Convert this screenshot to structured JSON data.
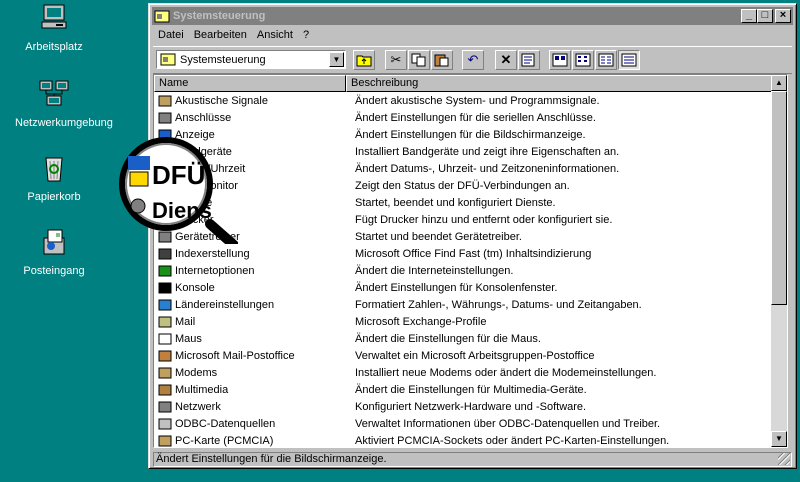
{
  "desktop": {
    "icons": [
      {
        "label": "Arbeitsplatz",
        "icon": "computer-icon"
      },
      {
        "label": "Netzwerkumgebung",
        "icon": "network-icon"
      },
      {
        "label": "Papierkorb",
        "icon": "recycle-bin-icon"
      },
      {
        "label": "Posteingang",
        "icon": "inbox-icon"
      }
    ]
  },
  "window": {
    "title": "Systemsteuerung",
    "controls": {
      "minimize": "_",
      "maximize": "□",
      "close": "×"
    }
  },
  "menu": {
    "items": [
      {
        "label": "Datei",
        "mnemonic": "D"
      },
      {
        "label": "Bearbeiten",
        "mnemonic": "B"
      },
      {
        "label": "Ansicht",
        "mnemonic": "A"
      },
      {
        "label": "?",
        "mnemonic": "?"
      }
    ]
  },
  "toolbar": {
    "address_value": "Systemsteuerung",
    "buttons": [
      "up-folder-icon",
      "cut-icon",
      "copy-icon",
      "paste-icon",
      "undo-icon",
      "delete-icon",
      "properties-icon",
      "large-icons-view-icon",
      "small-icons-view-icon",
      "list-view-icon",
      "details-view-icon"
    ]
  },
  "list": {
    "columns": [
      "Name",
      "Beschreibung"
    ],
    "rows": [
      {
        "name": "Akustische Signale",
        "desc": "Ändert akustische System- und Programmsignale."
      },
      {
        "name": "Anschlüsse",
        "desc": "Ändert Einstellungen für die seriellen Anschlüsse."
      },
      {
        "name": "Anzeige",
        "desc": "Ändert Einstellungen für die Bildschirmanzeige."
      },
      {
        "name": "Bandgeräte",
        "desc": "Installiert Bandgeräte und zeigt ihre Eigenschaften an."
      },
      {
        "name": "Datum/Uhrzeit",
        "desc": "Ändert Datums-, Uhrzeit- und Zeitzoneninformationen."
      },
      {
        "name": "DFÜ-Monitor",
        "desc": "Zeigt den Status der DFÜ-Verbindungen an."
      },
      {
        "name": "Dienste",
        "desc": "Startet, beendet und konfiguriert Dienste."
      },
      {
        "name": "Drucker",
        "desc": "Fügt Drucker hinzu und entfernt oder konfiguriert sie."
      },
      {
        "name": "Gerätetreiber",
        "desc": "Startet und beendet Gerätetreiber."
      },
      {
        "name": "Indexerstellung",
        "desc": "Microsoft Office Find Fast (tm) Inhaltsindizierung"
      },
      {
        "name": "Internetoptionen",
        "desc": "Ändert die Interneteinstellungen."
      },
      {
        "name": "Konsole",
        "desc": "Ändert Einstellungen für Konsolenfenster."
      },
      {
        "name": "Ländereinstellungen",
        "desc": "Formatiert Zahlen-, Währungs-, Datums- und Zeitangaben."
      },
      {
        "name": "Mail",
        "desc": "Microsoft Exchange-Profile"
      },
      {
        "name": "Maus",
        "desc": "Ändert die Einstellungen für die Maus."
      },
      {
        "name": "Microsoft Mail-Postoffice",
        "desc": "Verwaltet ein Microsoft Arbeitsgruppen-Postoffice"
      },
      {
        "name": "Modems",
        "desc": "Installiert neue Modems oder ändert die Modemeinstellungen."
      },
      {
        "name": "Multimedia",
        "desc": "Ändert die Einstellungen für Multimedia-Geräte."
      },
      {
        "name": "Netzwerk",
        "desc": "Konfiguriert Netzwerk-Hardware und -Software."
      },
      {
        "name": "ODBC-Datenquellen",
        "desc": "Verwaltet Informationen über ODBC-Datenquellen und Treiber."
      },
      {
        "name": "PC-Karte (PCMCIA)",
        "desc": "Aktiviert PCMCIA-Sockets oder ändert PC-Karten-Einstellungen."
      }
    ]
  },
  "status": {
    "text": "Ändert Einstellungen für die Bildschirmanzeige."
  },
  "magnifier": {
    "line1": "DFÜ",
    "line2": "Diens"
  }
}
